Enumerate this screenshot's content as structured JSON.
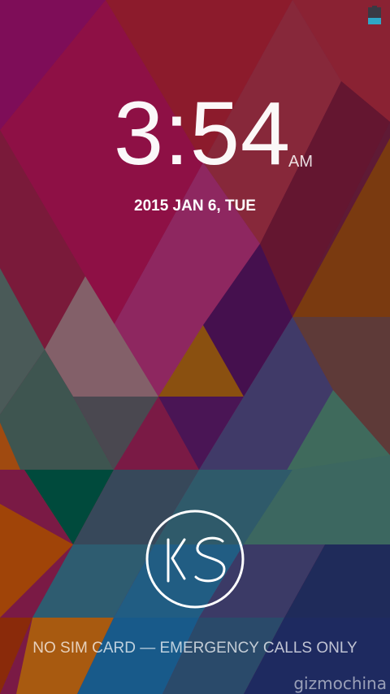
{
  "status_bar": {
    "battery_icon": "battery-icon",
    "battery_level": 0.4,
    "battery_color": "#2fa7c7"
  },
  "lockscreen": {
    "clock": {
      "time": "3:54",
      "ampm": "AM"
    },
    "date": "2015 JAN 6, TUE",
    "unlock_logo": {
      "icon": "ks-logo-icon",
      "text": "KS"
    },
    "carrier_text": "NO SIM CARD — EMERGENCY CALLS ONLY"
  },
  "watermark": "gizmochina"
}
